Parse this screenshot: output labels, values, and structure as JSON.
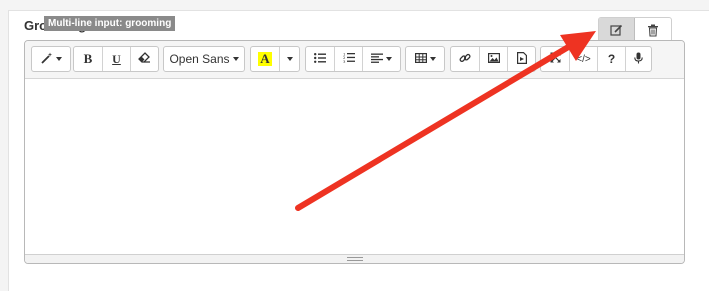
{
  "field": {
    "label": "Grooming",
    "tooltip": "Multi-line input: grooming"
  },
  "actions": [
    {
      "icon": "edit-icon"
    },
    {
      "icon": "trash-icon"
    }
  ],
  "toolbar": {
    "bold_label": "B",
    "underline_label": "U",
    "font_name": "Open Sans",
    "text_color_label": "A",
    "text_color_highlight": "#ffff00",
    "help_label": "?",
    "code_view_label": "</>"
  },
  "editor": {
    "content": ""
  },
  "annotation": {
    "arrow_color": "#ee3322"
  }
}
